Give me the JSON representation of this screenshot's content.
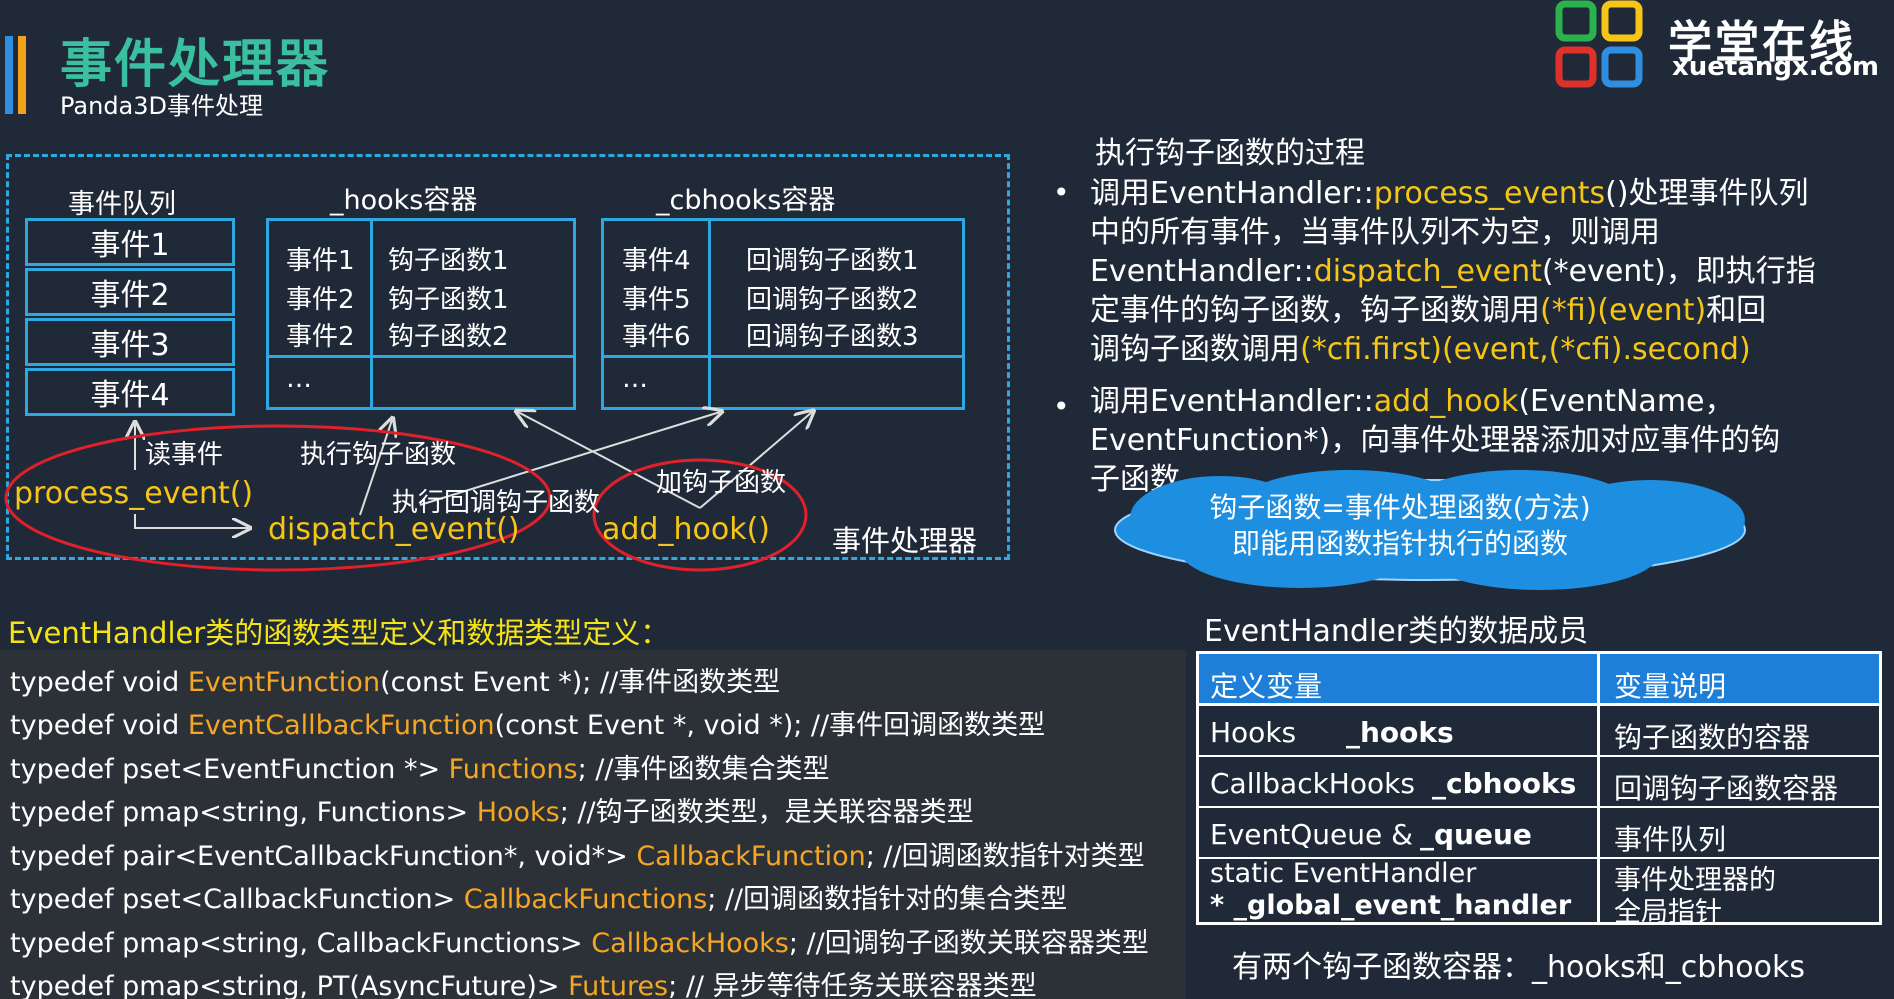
{
  "header": {
    "title": "事件处理器",
    "subtitle": "Panda3D事件处理",
    "logo_cn": "学堂在线",
    "logo_en": "xuetangx.com"
  },
  "diagram": {
    "queue_title": "事件队列",
    "queue_items": [
      "事件1",
      "事件2",
      "事件3",
      "事件4"
    ],
    "hooks_title": "_hooks容器",
    "hooks_rows": [
      {
        "event": "事件1",
        "hook": "钩子函数1"
      },
      {
        "event": "事件2",
        "hook": "钩子函数1"
      },
      {
        "event": "事件2",
        "hook": "钩子函数2"
      },
      {
        "event": "…",
        "hook": ""
      }
    ],
    "cbhooks_title": "_cbhooks容器",
    "cbhooks_rows": [
      {
        "event": "事件4",
        "hook": "回调钩子函数1"
      },
      {
        "event": "事件5",
        "hook": "回调钩子函数2"
      },
      {
        "event": "事件6",
        "hook": "回调钩子函数3"
      },
      {
        "event": "…",
        "hook": ""
      }
    ],
    "label_read_event": "读事件",
    "label_exec_hook": "执行钩子函数",
    "label_exec_cb_hook": "执行回调钩子函数",
    "label_add_hook": "加钩子函数",
    "fn_process_event": "process_event()",
    "fn_dispatch_event": "dispatch_event()",
    "fn_add_hook": "add_hook()",
    "label_event_handler": "事件处理器"
  },
  "explanation": {
    "heading": "执行钩子函数的过程",
    "bullet1": {
      "line1_a": "调用EventHandler::",
      "line1_hl": "process_events",
      "line1_b": "()处理事件队列",
      "line2": "中的所有事件，当事件队列不为空，则调用",
      "line3_a": "EventHandler::",
      "line3_hl": "dispatch_event",
      "line3_b": "(*event)，即执行指",
      "line4_a": "定事件的钩子函数，钩子函数调用",
      "line4_hl": "(*fi)(event)",
      "line4_b": "和回",
      "line5_a": "调钩子函数调用",
      "line5_hl": "(*cfi.first)(event,(*cfi).second)"
    },
    "bullet2": {
      "line1_a": "调用EventHandler::",
      "line1_hl": "add_hook",
      "line1_b": "(EventName，",
      "line2": "EventFunction*)，向事件处理器添加对应事件的钩",
      "line3": "子函数"
    },
    "cloud_line1": "钩子函数=事件处理函数(方法)",
    "cloud_line2": "即能用函数指针执行的函数"
  },
  "code": {
    "heading": "EventHandler类的函数类型定义和数据类型定义：",
    "lines": [
      {
        "pre": "typedef void ",
        "type": "EventFunction",
        "post": "(const Event *);  //事件函数类型"
      },
      {
        "pre": "typedef void ",
        "type": "EventCallbackFunction",
        "post": "(const Event *, void *);   //事件回调函数类型"
      },
      {
        "pre": "typedef pset<EventFunction *>   ",
        "type": "Functions",
        "post": ";  //事件函数集合类型"
      },
      {
        "pre": "typedef pmap<string, Functions>   ",
        "type": "Hooks",
        "post": ";         //钩子函数类型，是关联容器类型"
      },
      {
        "pre": "typedef pair<EventCallbackFunction*, void*>   ",
        "type": "CallbackFunction",
        "post": "; //回调函数指针对类型"
      },
      {
        "pre": "typedef pset<CallbackFunction>   ",
        "type": "CallbackFunctions",
        "post": ";   //回调函数指针对的集合类型"
      },
      {
        "pre": "typedef pmap<string, CallbackFunctions>   ",
        "type": "CallbackHooks",
        "post": "; //回调钩子函数关联容器类型"
      },
      {
        "pre": "typedef pmap<string, PT(AsyncFuture)>   ",
        "type": "Futures",
        "post": ";   // 异步等待任务关联容器类型"
      }
    ]
  },
  "members": {
    "heading": "EventHandler类的数据成员",
    "col1_header": "定义变量",
    "col2_header": "变量说明",
    "rows": [
      {
        "type": "Hooks",
        "var": "_hooks",
        "desc": "钩子函数的容器"
      },
      {
        "type": "CallbackHooks",
        "var": "_cbhooks",
        "desc": "回调钩子函数容器"
      },
      {
        "type": "EventQueue &",
        "var": "_queue",
        "desc": "事件队列"
      }
    ],
    "last_row": {
      "line1": "static  EventHandler",
      "line2": "* _global_event_handler",
      "desc1": "事件处理器的",
      "desc2": "全局指针"
    },
    "note": "有两个钩子函数容器：_hooks和_cbhooks"
  },
  "colors": {
    "background": "#1f2938",
    "accent_blue": "#2fa8e0",
    "title_green": "#3ac0a0",
    "highlight_yellow": "#f5c518",
    "type_orange": "#f5a623",
    "ellipse_red": "#e0202a"
  }
}
